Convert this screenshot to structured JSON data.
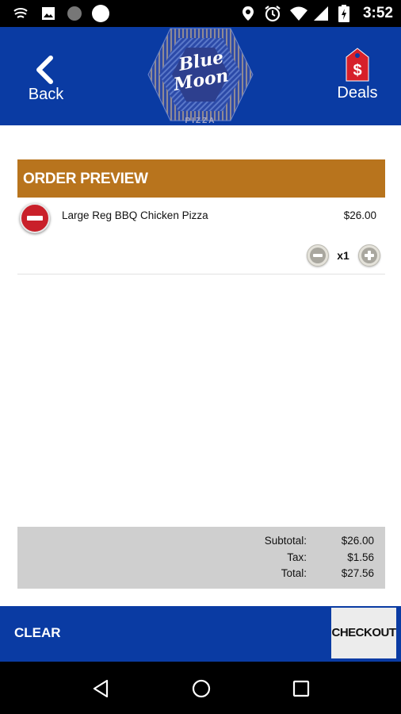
{
  "status_bar": {
    "time": "3:52",
    "left_icons": [
      "notification-icon",
      "image-icon",
      "circle-icon",
      "circle-filled-icon"
    ],
    "right_icons": [
      "location-icon",
      "alarm-icon",
      "wifi-icon",
      "signal-icon",
      "battery-icon"
    ]
  },
  "header": {
    "back_label": "Back",
    "deals_label": "Deals",
    "logo": {
      "line1": "Blue",
      "line2": "Moon",
      "subtitle": "PIZZA"
    },
    "colors": {
      "bar": "#0a3ba3",
      "deals_tag": "#d6202a"
    }
  },
  "order": {
    "section_title": "ORDER PREVIEW",
    "section_color": "#b8741d",
    "items": [
      {
        "name": "Large Reg BBQ Chicken Pizza",
        "price": "$26.00",
        "quantity": "x1"
      }
    ]
  },
  "totals": {
    "subtotal_label": "Subtotal:",
    "subtotal_value": "$26.00",
    "tax_label": "Tax:",
    "tax_value": "$1.56",
    "total_label": "Total:",
    "total_value": "$27.56"
  },
  "footer": {
    "clear_label": "CLEAR",
    "checkout_label": "CHECKOUT"
  },
  "nav_bar": {
    "icons": [
      "back-triangle-icon",
      "home-circle-icon",
      "recents-square-icon"
    ]
  }
}
